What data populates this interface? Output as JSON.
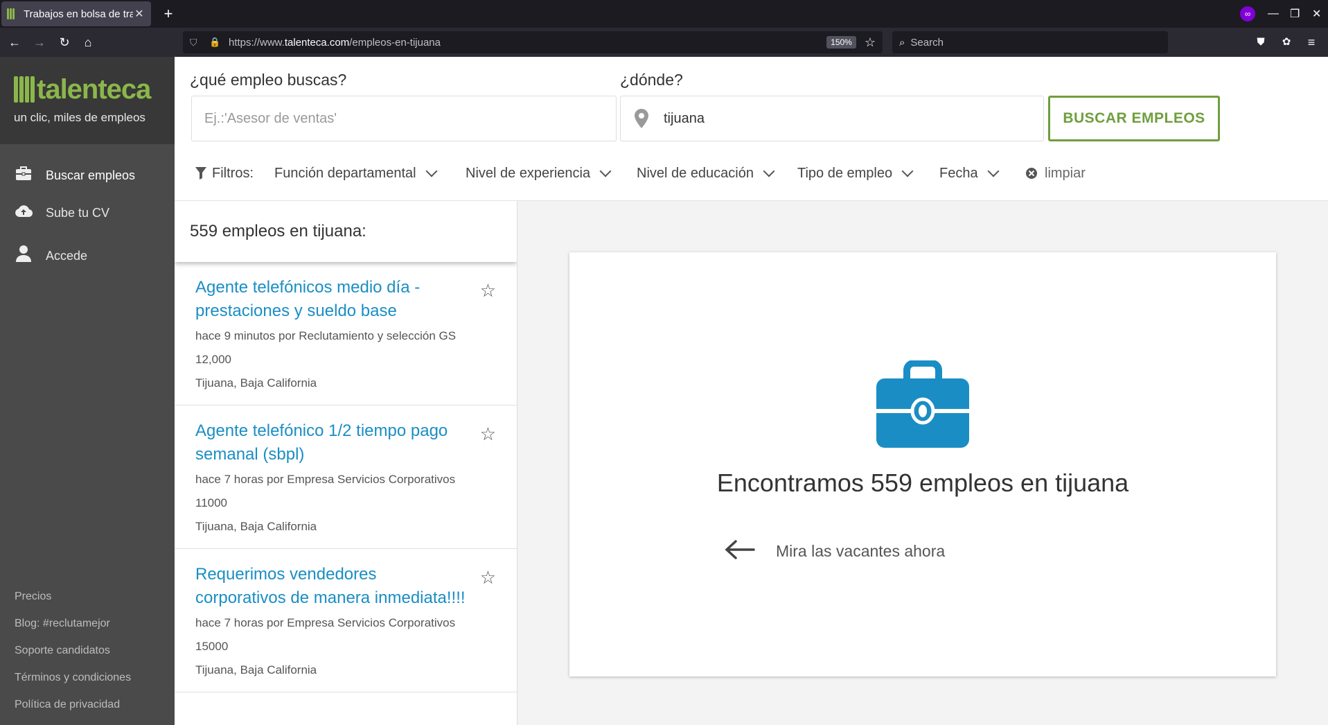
{
  "browser": {
    "tab_title": "Trabajos en bolsa de trab",
    "url_prefix": "https://www.",
    "url_domain": "talenteca.com",
    "url_path": "/empleos-en-tijuana",
    "zoom": "150%",
    "search_placeholder": "Search"
  },
  "sidebar": {
    "logo_text": "talenteca",
    "tagline": "un clic, miles de empleos",
    "menu": [
      {
        "label": "Buscar empleos",
        "icon": "briefcase-icon"
      },
      {
        "label": "Sube tu CV",
        "icon": "cloud-upload-icon"
      },
      {
        "label": "Accede",
        "icon": "user-icon"
      }
    ],
    "footer_links": [
      "Precios",
      "Blog: #reclutamejor",
      "Soporte candidatos",
      "Términos y condiciones",
      "Política de privacidad"
    ]
  },
  "search": {
    "what_label": "¿qué empleo buscas?",
    "what_placeholder": "Ej.:'Asesor de ventas'",
    "where_label": "¿dónde?",
    "where_value": "tijuana",
    "button_label": "BUSCAR EMPLEOS"
  },
  "filters": {
    "label": "Filtros:",
    "items": [
      "Función departamental",
      "Nivel de experiencia",
      "Nivel de educación",
      "Tipo de empleo",
      "Fecha"
    ],
    "clear_label": "limpiar"
  },
  "results": {
    "heading": "559 empleos en tijuana:",
    "jobs": [
      {
        "title": "Agente telefónicos medio día - prestaciones y sueldo base",
        "posted": "hace 9 minutos por Reclutamiento y selección GS",
        "salary": "12,000",
        "location": "Tijuana, Baja California"
      },
      {
        "title": "Agente telefónico 1/2 tiempo pago semanal (sbpl)",
        "posted": "hace 7 horas por Empresa Servicios Corporativos",
        "salary": "11000",
        "location": "Tijuana, Baja California"
      },
      {
        "title": "Requerimos vendedores corporativos de manera inmediata!!!!",
        "posted": "hace 7 horas por Empresa Servicios Corporativos",
        "salary": "15000",
        "location": "Tijuana, Baja California"
      }
    ]
  },
  "panel": {
    "title": "Encontramos 559 empleos en tijuana",
    "link": "Mira las vacantes ahora"
  },
  "colors": {
    "brand_green": "#8bb74a",
    "link_blue": "#1a8ec4",
    "briefcase_blue": "#1a8ec4"
  }
}
